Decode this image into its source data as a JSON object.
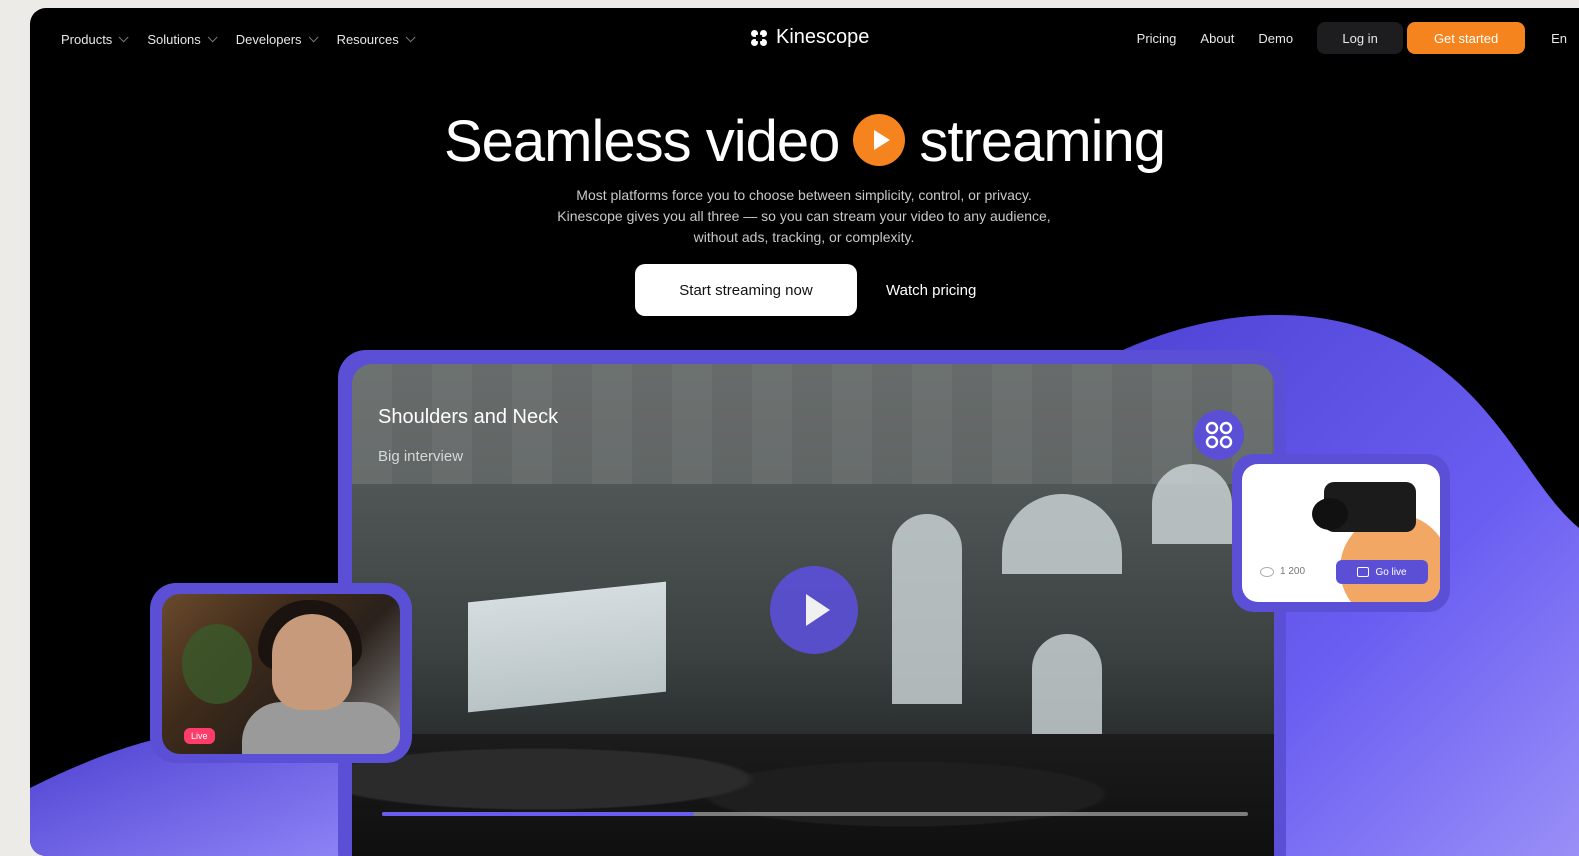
{
  "nav": {
    "left_items": [
      "Products",
      "Solutions",
      "Developers",
      "Resources"
    ],
    "brand": "Kinescope",
    "right_links": [
      "Pricing",
      "About",
      "Demo"
    ],
    "login_label": "Log in",
    "get_started_label": "Get started",
    "language": "En"
  },
  "hero": {
    "title_part1": "Seamless video",
    "title_part2": "streaming",
    "subtitle_line1": "Most platforms force you to choose between simplicity, control, or privacy.",
    "subtitle_line2": "Kinescope gives you all three — so you can stream your video to any audience,",
    "subtitle_line3": "without ads, tracking, or complexity.",
    "primary_cta": "Start streaming now",
    "secondary_cta": "Watch pricing"
  },
  "player": {
    "title": "Shoulders and Neck",
    "subtitle": "Big interview",
    "progress": 0.36
  },
  "mini_left": {
    "badge": "Live"
  },
  "mini_right": {
    "viewers": "1 200",
    "button_label": "Go live"
  },
  "colors": {
    "accent_orange": "#f5841f",
    "accent_purple": "#5b4fd6",
    "background": "#000000"
  }
}
